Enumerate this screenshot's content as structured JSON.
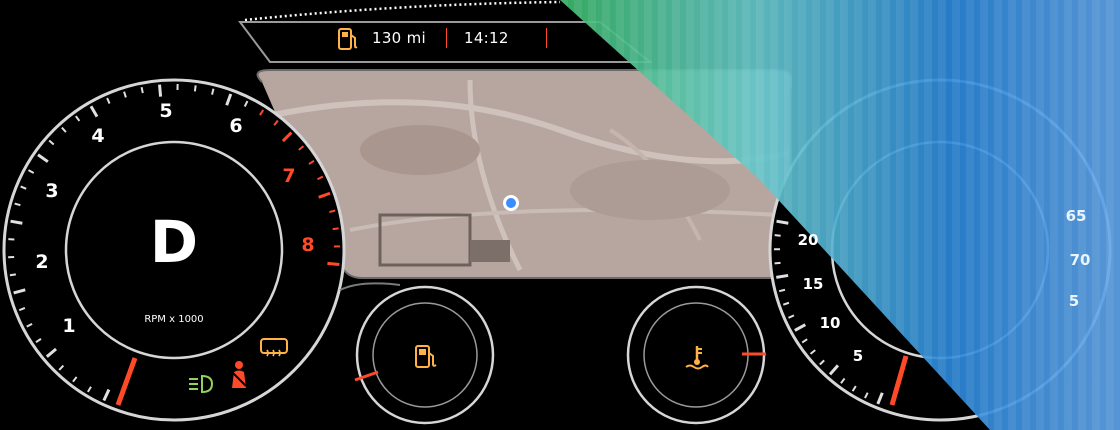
{
  "top_bar": {
    "range": "130 mi",
    "time": "14:12"
  },
  "tachometer": {
    "gear": "D",
    "unit_label": "RPM x 1000",
    "scale": [
      "1",
      "2",
      "3",
      "4",
      "5",
      "6",
      "7",
      "8"
    ],
    "redline_from": "7"
  },
  "speedometer": {
    "scale": [
      "5",
      "10",
      "15",
      "20"
    ],
    "far_scale": [
      "65",
      "70",
      "5"
    ]
  },
  "fuel_gauge": {
    "icon": "fuel-pump-icon"
  },
  "temp_gauge": {
    "icon": "coolant-temp-icon"
  },
  "map": {
    "location_marker": "current-location-dot"
  },
  "warning_icons": [
    "rear-defrost-icon",
    "headlight-icon",
    "seatbelt-warning-icon"
  ],
  "colors": {
    "accent_red": "#ff4a2a",
    "amber": "#ffb347",
    "green_indicator": "#8fd35a",
    "map_ground": "#b9a8a2",
    "ring": "#d9d9d9"
  }
}
